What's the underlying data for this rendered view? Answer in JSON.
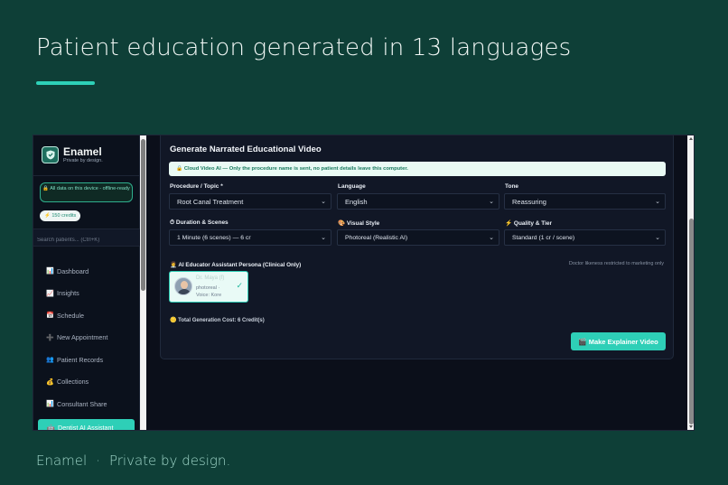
{
  "slide": {
    "headline": "Patient education generated in 13 languages",
    "footer_brand": "Enamel",
    "footer_separator": "·",
    "footer_tagline": "Private by design."
  },
  "sidebar": {
    "brand_name": "Enamel",
    "brand_tagline": "Private by design.",
    "offline_badge": "🔒 All data on this device - offline-ready",
    "credits": "⚡ 150 credits",
    "search_placeholder": "Search patients... (Ctrl+K)",
    "items": [
      {
        "icon": "📊",
        "label": "Dashboard"
      },
      {
        "icon": "📈",
        "label": "Insights"
      },
      {
        "icon": "📅",
        "label": "Schedule"
      },
      {
        "icon": "➕",
        "label": "New Appointment"
      },
      {
        "icon": "👥",
        "label": "Patient Records"
      },
      {
        "icon": "💰",
        "label": "Collections"
      },
      {
        "icon": "📊",
        "label": "Consultant Share"
      },
      {
        "icon": "🤖",
        "label": "Dentist AI Assistant"
      }
    ]
  },
  "main": {
    "title": "Generate Narrated Educational Video",
    "notice": "🔒 Cloud Video AI — Only the procedure name is sent, no patient details leave this computer.",
    "procedure_label": "Procedure / Topic *",
    "procedure_value": "Root Canal Treatment",
    "language_label": "Language",
    "language_value": "English",
    "tone_label": "Tone",
    "tone_value": "Reassuring",
    "duration_label": "⏱ Duration & Scenes",
    "duration_value": "1 Minute (6 scenes) — 6 cr",
    "visual_label": "🎨 Visual Style",
    "visual_value": "Photoreal (Realistic AI)",
    "quality_label": "⚡ Quality & Tier",
    "quality_value": "Standard (1 cr / scene)",
    "persona_label": "👩‍⚕️ AI Educator Assistant Persona (Clinical Only)",
    "persona_note": "Doctor likeness restricted to marketing only",
    "persona_name": "Dr. Maya (f)",
    "persona_style": "photoreal ·",
    "persona_voice": "Voice: Kore",
    "cost": "🪙 Total Generation Cost: 6 Credit(s)",
    "make_button": "🎬 Make Explainer Video"
  }
}
